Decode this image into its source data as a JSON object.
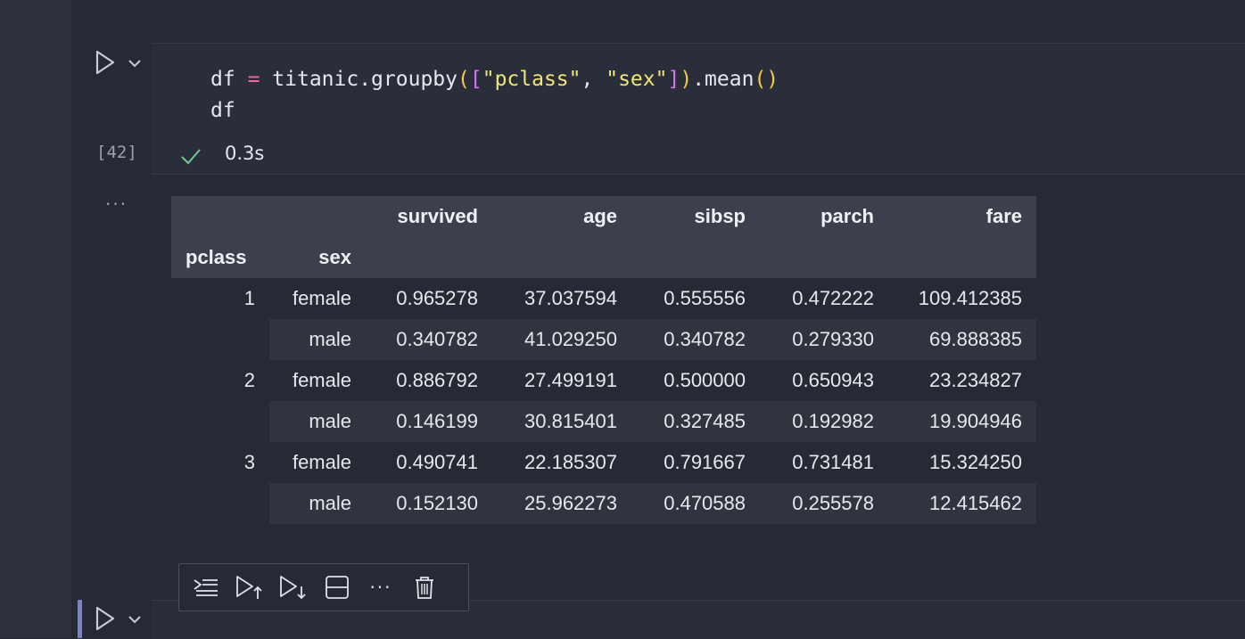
{
  "cell": {
    "code_line1": {
      "v1": "df",
      "eq": "=",
      "obj": "titanic.groupby",
      "p1": "(",
      "b1": "[",
      "s1": "\"pclass\"",
      "comma": ",",
      "s2": "\"sex\"",
      "b2": "]",
      "p2": ")",
      "dot": ".mean",
      "p3": "(",
      "p4": ")"
    },
    "code_line2": "df",
    "execution_count": "[42]",
    "exec_time": "0.3s",
    "output_menu": "···"
  },
  "dataframe": {
    "columns": [
      "survived",
      "age",
      "sibsp",
      "parch",
      "fare"
    ],
    "index_names": [
      "pclass",
      "sex"
    ],
    "rows": [
      {
        "pclass": "1",
        "sex": "female",
        "values": [
          "0.965278",
          "37.037594",
          "0.555556",
          "0.472222",
          "109.412385"
        ]
      },
      {
        "pclass": "",
        "sex": "male",
        "values": [
          "0.340782",
          "41.029250",
          "0.340782",
          "0.279330",
          "69.888385"
        ]
      },
      {
        "pclass": "2",
        "sex": "female",
        "values": [
          "0.886792",
          "27.499191",
          "0.500000",
          "0.650943",
          "23.234827"
        ]
      },
      {
        "pclass": "",
        "sex": "male",
        "values": [
          "0.146199",
          "30.815401",
          "0.327485",
          "0.192982",
          "19.904946"
        ]
      },
      {
        "pclass": "3",
        "sex": "female",
        "values": [
          "0.490741",
          "22.185307",
          "0.791667",
          "0.731481",
          "15.324250"
        ]
      },
      {
        "pclass": "",
        "sex": "male",
        "values": [
          "0.152130",
          "25.962273",
          "0.470588",
          "0.255578",
          "12.415462"
        ]
      }
    ]
  },
  "toolbar": {
    "icons": [
      "execute-above-icon",
      "run-above-icon",
      "run-below-icon",
      "split-cell-icon",
      "more-icon",
      "trash-icon"
    ],
    "more_label": "···"
  },
  "colors": {
    "accent": "#7a83c8",
    "success": "#73c991",
    "keyword_op": "#ff5fa8",
    "string": "#eee67a"
  }
}
